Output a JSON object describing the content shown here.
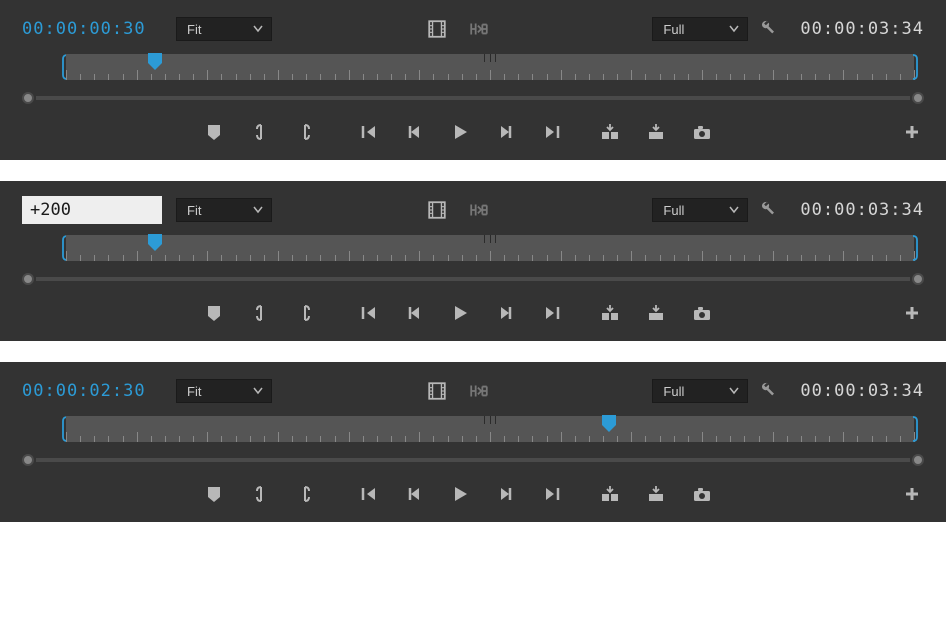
{
  "panels": [
    {
      "timecode_mode": "label",
      "timecode": "00:00:00:30",
      "timecode_input": "",
      "zoom_label": "Fit",
      "resolution_label": "Full",
      "duration": "00:00:03:34",
      "playhead_percent": 10.5
    },
    {
      "timecode_mode": "input",
      "timecode": "",
      "timecode_input": "+200",
      "zoom_label": "Fit",
      "resolution_label": "Full",
      "duration": "00:00:03:34",
      "playhead_percent": 10.5
    },
    {
      "timecode_mode": "label",
      "timecode": "00:00:02:30",
      "timecode_input": "",
      "zoom_label": "Fit",
      "resolution_label": "Full",
      "duration": "00:00:03:34",
      "playhead_percent": 64
    }
  ],
  "icons": {
    "chevron": "chevron-down-icon",
    "filmstrip": "filmstrip-icon",
    "safemargins": "safe-margins-icon",
    "wrench": "wrench-icon",
    "marker": "marker-icon",
    "inpoint": "mark-in-icon",
    "outpoint": "mark-out-icon",
    "gotoin": "go-to-in-icon",
    "stepback": "step-back-icon",
    "play": "play-icon",
    "stepfwd": "step-forward-icon",
    "gotoout": "go-to-out-icon",
    "insert": "insert-icon",
    "overwrite": "overwrite-icon",
    "snapshot": "export-frame-icon",
    "add": "button-editor-icon"
  }
}
